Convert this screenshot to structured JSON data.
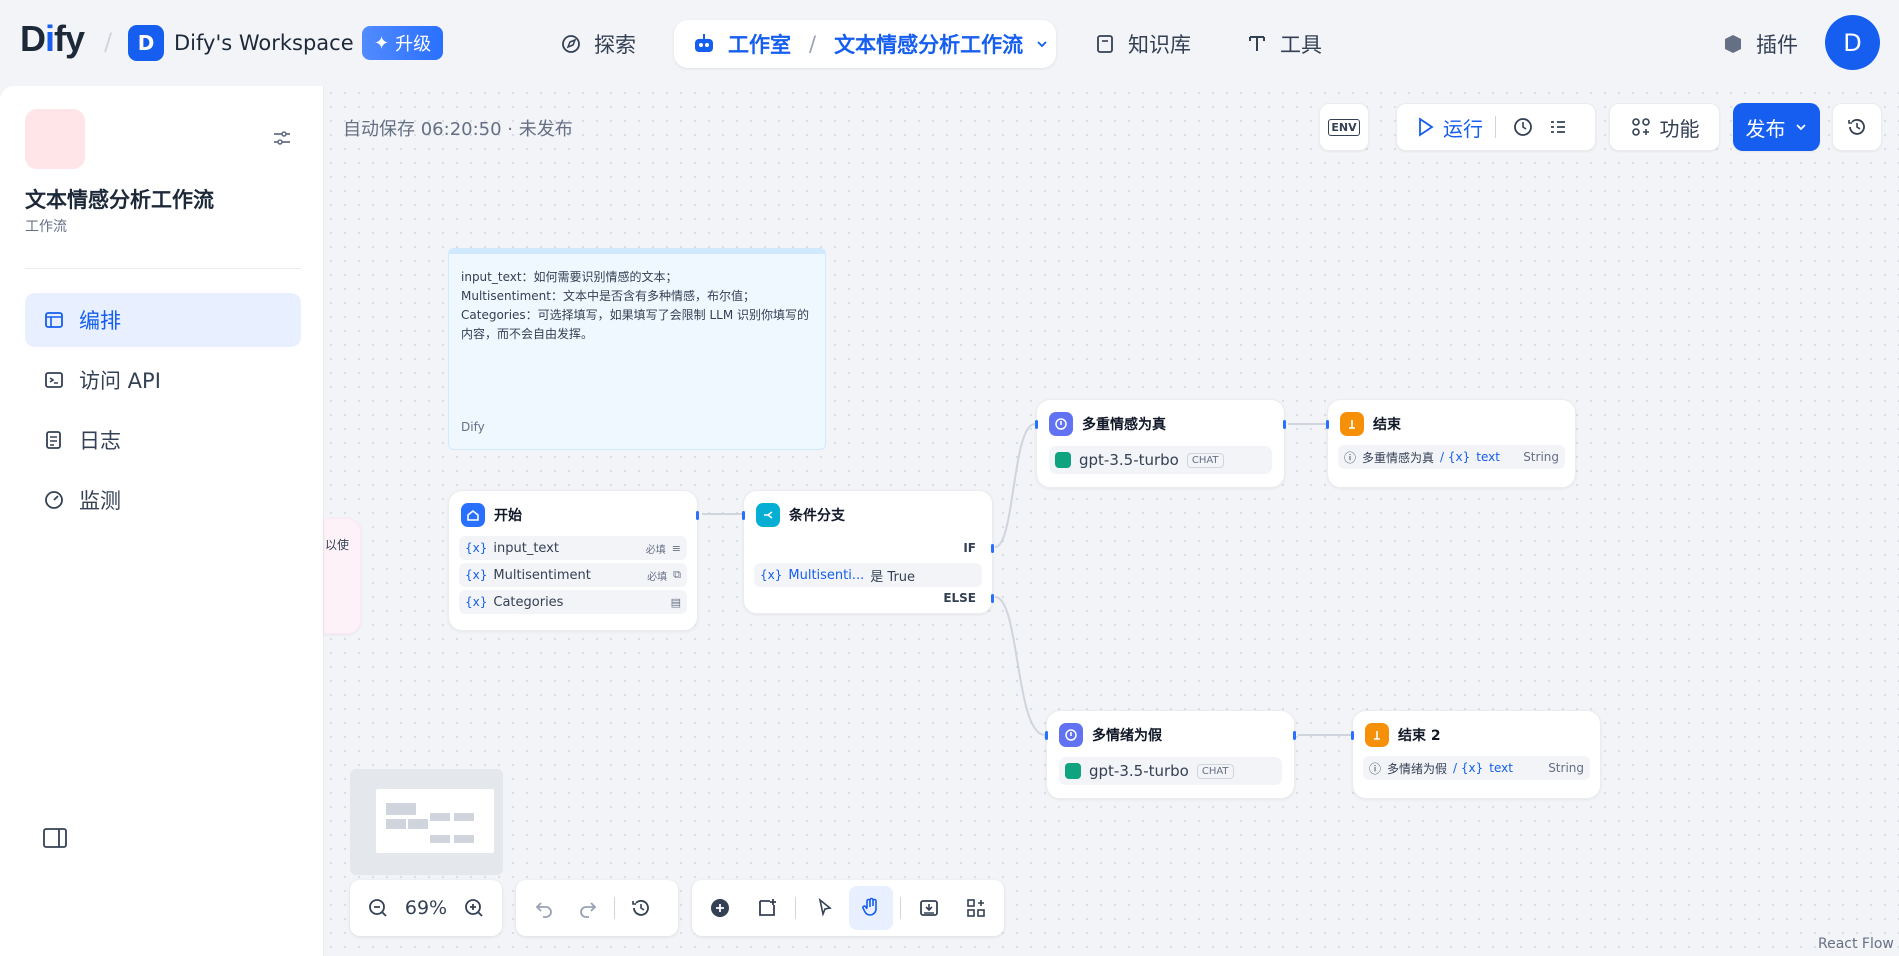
{
  "header": {
    "logo_prefix": "D",
    "logo_mid": "ify",
    "logo_i": "i",
    "workspace_initial": "D",
    "workspace_name": "Dify's Workspace",
    "upgrade_label": "升级",
    "nav": {
      "explore": "探索",
      "studio": "工作室",
      "current_app": "文本情感分析工作流",
      "knowledge": "知识库",
      "tools": "工具",
      "plugins": "插件"
    },
    "user_initial": "D"
  },
  "sidebar": {
    "app_title": "文本情感分析工作流",
    "app_type": "工作流",
    "items": [
      {
        "label": "编排",
        "icon": "layout-icon",
        "active": true
      },
      {
        "label": "访问 API",
        "icon": "terminal-icon",
        "active": false
      },
      {
        "label": "日志",
        "icon": "log-icon",
        "active": false
      },
      {
        "label": "监测",
        "icon": "gauge-icon",
        "active": false
      }
    ]
  },
  "canvas": {
    "autosave": "自动保存 06:20:50 · 未发布",
    "toolbar": {
      "env": "ENV",
      "run": "运行",
      "features": "功能",
      "publish": "发布"
    },
    "note": {
      "lines": [
        "input_text：如何需要识别情感的文本；",
        "Multisentiment：文本中是否含有多种情感，布尔值；",
        "Categories：可选择填写，如果填写了会限制 LLM 识别你填写的内容，而不会自由发挥。"
      ],
      "author": "Dify"
    },
    "partial_node_text": "以使",
    "nodes": {
      "start": {
        "title": "开始",
        "vars": [
          {
            "name": "input_text",
            "badge": "必填"
          },
          {
            "name": "Multisentiment",
            "badge": "必填"
          },
          {
            "name": "Categories",
            "badge": ""
          }
        ]
      },
      "ifelse": {
        "title": "条件分支",
        "if_label": "IF",
        "else_label": "ELSE",
        "condition_var": "Multisenti...",
        "condition_op": "是 True"
      },
      "llm_true": {
        "title": "多重情感为真",
        "model": "gpt-3.5-turbo",
        "mode": "CHAT"
      },
      "llm_false": {
        "title": "多情绪为假",
        "model": "gpt-3.5-turbo",
        "mode": "CHAT"
      },
      "end1": {
        "title": "结束",
        "source": "多重情感为真",
        "var": "text",
        "type": "String"
      },
      "end2": {
        "title": "结束 2",
        "source": "多情绪为假",
        "var": "text",
        "type": "String"
      }
    },
    "zoom": "69%",
    "watermark": "React Flow"
  },
  "colors": {
    "accent": "#155eef",
    "start_icon": "#2970ff",
    "ifelse_icon": "#06aed4",
    "llm_icon": "#6172f3",
    "end_icon": "#f79009"
  }
}
